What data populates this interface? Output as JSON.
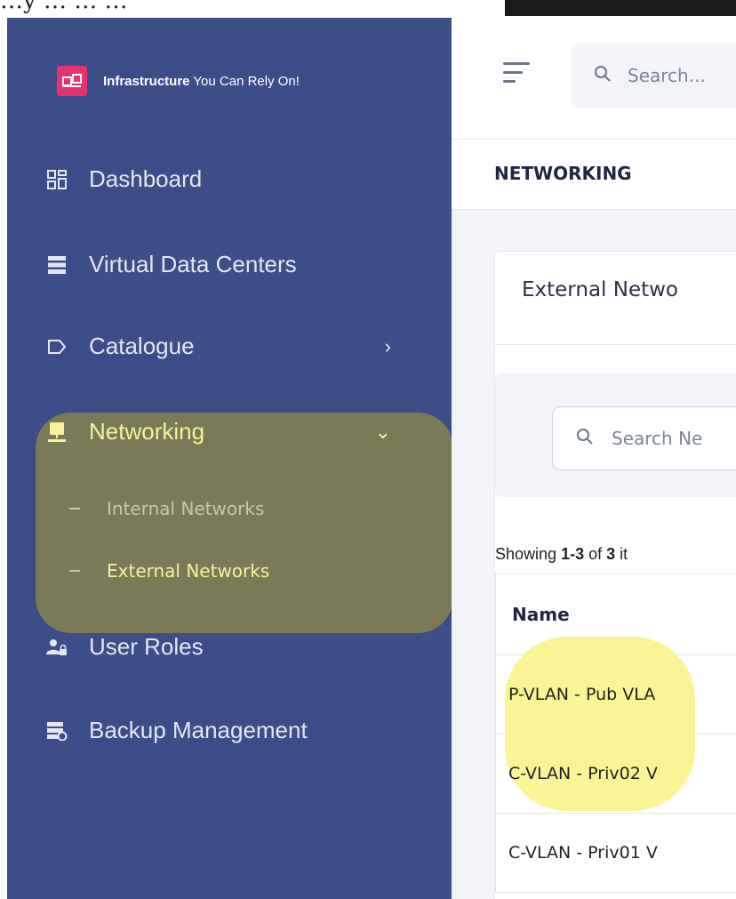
{
  "top_strip_text": "…y  …                    …            …     ⁠",
  "brand": {
    "name_bold": "Infrastructure",
    "name_rest": " You Can Rely On!"
  },
  "sidebar": {
    "items": [
      {
        "label": "Dashboard",
        "icon": "dashboard-grid-icon"
      },
      {
        "label": "Virtual Data Centers",
        "icon": "server-stack-icon"
      },
      {
        "label": "Catalogue",
        "icon": "tag-icon"
      },
      {
        "label": "Networking",
        "icon": "monitor-icon"
      },
      {
        "label": "User Roles",
        "icon": "user-lock-icon"
      },
      {
        "label": "Backup Management",
        "icon": "backup-server-icon"
      }
    ],
    "submenu": [
      {
        "label": "Internal Networks"
      },
      {
        "label": "External Networks"
      }
    ]
  },
  "header": {
    "search_placeholder": "Search..."
  },
  "breadcrumb": {
    "title": "NETWORKING"
  },
  "card": {
    "title": "External Netwo",
    "filter_placeholder": "Search Ne",
    "showing_prefix": "Showing ",
    "showing_range": "1-3",
    "showing_mid": " of ",
    "showing_total": "3",
    "showing_suffix": " it",
    "table": {
      "header": "Name",
      "rows": [
        "P-VLAN - Pub VLA",
        "C-VLAN - Priv02 V",
        "C-VLAN - Priv01 V"
      ]
    }
  },
  "colors": {
    "sidebar": "#3d4d87",
    "brand_logo": "#e8316f",
    "highlight_nav": "#7a7a57",
    "highlight_text": "#f6f29a",
    "yellow_blob": "#f9f597"
  }
}
